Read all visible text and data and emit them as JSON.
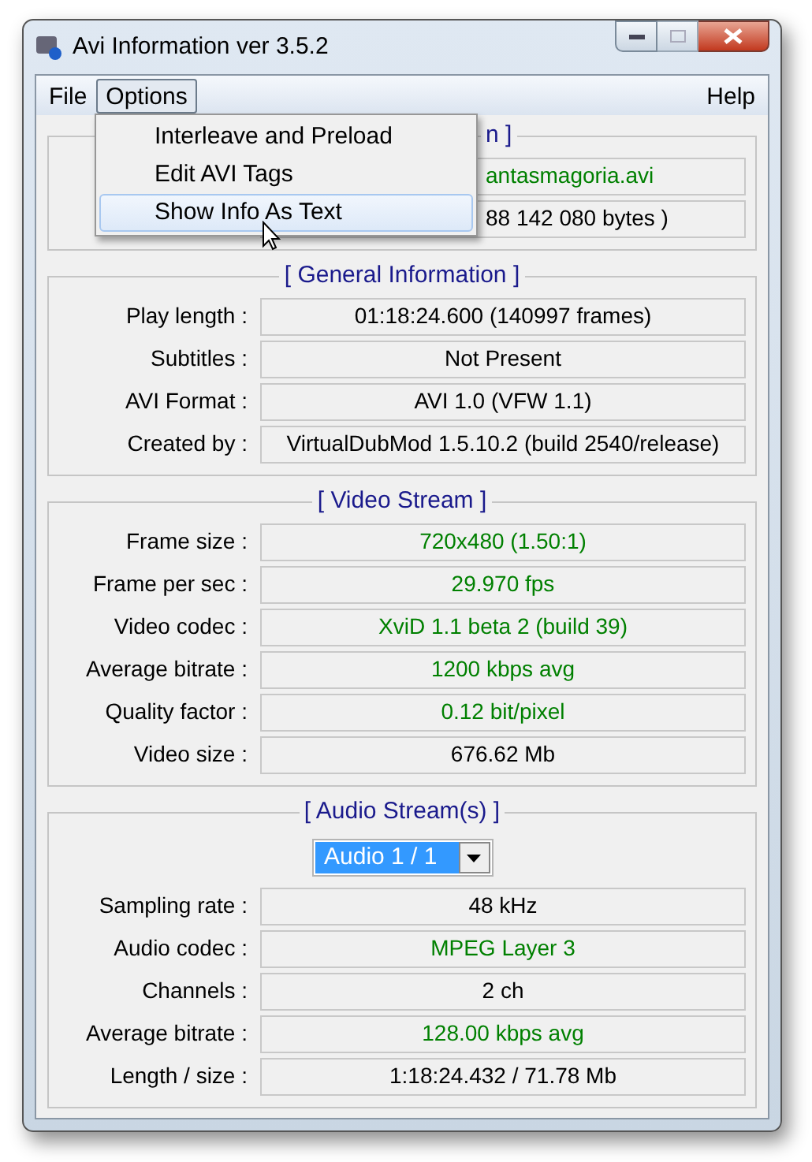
{
  "window": {
    "title": "Avi Information ver 3.5.2"
  },
  "menu": [
    {
      "label": "File",
      "selected": false
    },
    {
      "label": "Options",
      "selected": true
    },
    {
      "label": "Help",
      "selected": false
    }
  ],
  "options_menu": [
    {
      "label": "Interleave and Preload",
      "selected": false
    },
    {
      "label": "Edit AVI Tags",
      "selected": false
    },
    {
      "label": "Show Info As Text",
      "selected": true
    }
  ],
  "file_group": {
    "title": "n ]",
    "rows": [
      {
        "value": "antasmagoria.avi",
        "color": "#008000"
      },
      {
        "value": "88 142 080 bytes )",
        "color": "#000000"
      }
    ]
  },
  "groups": [
    {
      "title": "[ General Information ]",
      "rows": [
        {
          "label": "Play length :",
          "value": "01:18:24.600 (140997 frames)",
          "color": "#000000"
        },
        {
          "label": "Subtitles :",
          "value": "Not Present",
          "color": "#000000"
        },
        {
          "label": "AVI Format :",
          "value": "AVI 1.0 (VFW 1.1)",
          "color": "#000000"
        },
        {
          "label": "Created by :",
          "value": "VirtualDubMod 1.5.10.2 (build 2540/release)",
          "color": "#000000"
        }
      ]
    },
    {
      "title": "[ Video Stream ]",
      "rows": [
        {
          "label": "Frame size :",
          "value": "720x480 (1.50:1)",
          "color": "#008000"
        },
        {
          "label": "Frame per sec :",
          "value": "29.970 fps",
          "color": "#008000"
        },
        {
          "label": "Video codec :",
          "value": "XviD 1.1 beta 2 (build 39)",
          "color": "#008000"
        },
        {
          "label": "Average bitrate :",
          "value": "1200 kbps avg",
          "color": "#008000"
        },
        {
          "label": "Quality factor :",
          "value": "0.12 bit/pixel",
          "color": "#008000"
        },
        {
          "label": "Video size :",
          "value": "676.62 Mb",
          "color": "#000000"
        }
      ]
    },
    {
      "title": "[ Audio Stream(s) ]",
      "dropdown": "Audio 1 / 1",
      "rows": [
        {
          "label": "Sampling rate :",
          "value": "48 kHz",
          "color": "#000000"
        },
        {
          "label": "Audio codec :",
          "value": "MPEG Layer 3",
          "color": "#008000"
        },
        {
          "label": "Channels :",
          "value": "2 ch",
          "color": "#000000"
        },
        {
          "label": "Average bitrate :",
          "value": "128.00 kbps avg",
          "color": "#008000"
        },
        {
          "label": "Length / size :",
          "value": "1:18:24.432 / 71.78 Mb",
          "color": "#000000"
        }
      ]
    }
  ]
}
